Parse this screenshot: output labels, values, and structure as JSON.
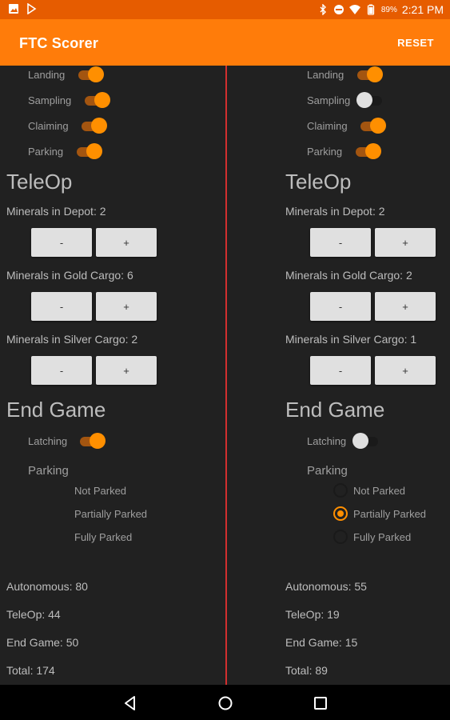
{
  "status_bar": {
    "time": "2:21 PM",
    "battery": "89%",
    "icons": [
      "image-icon",
      "play-store-icon",
      "bluetooth-icon",
      "dnd-icon",
      "wifi-icon",
      "battery-icon"
    ]
  },
  "app_bar": {
    "title": "FTC Scorer",
    "reset_label": "RESET"
  },
  "colors": {
    "accent": "#ff7c0a",
    "divider": "#d32f2f",
    "background": "#212121"
  },
  "teams": [
    {
      "auto": {
        "landing": "Landing",
        "sampling": "Sampling",
        "claiming": "Claiming",
        "parking": "Parking"
      },
      "auto_state": {
        "landing": true,
        "sampling": true,
        "claiming": true,
        "parking": true
      },
      "teleop_title": "TeleOp",
      "depot_label": "Minerals in Depot: 2",
      "gold_label": "Minerals in Gold Cargo: 6",
      "silver_label": "Minerals in Silver Cargo: 2",
      "minus": "-",
      "plus": "+",
      "end_title": "End Game",
      "latching": "Latching",
      "latching_state": true,
      "parking_title": "Parking",
      "parking_options": [
        "Not Parked",
        "Partially Parked",
        "Fully Parked"
      ],
      "parking_selected": null,
      "summary": {
        "auto": "Autonomous: 80",
        "teleop": "TeleOp: 44",
        "end": "End Game: 50",
        "total": "Total: 174"
      }
    },
    {
      "auto": {
        "landing": "Landing",
        "sampling": "Sampling",
        "claiming": "Claiming",
        "parking": "Parking"
      },
      "auto_state": {
        "landing": true,
        "sampling": false,
        "claiming": true,
        "parking": true
      },
      "teleop_title": "TeleOp",
      "depot_label": "Minerals in Depot: 2",
      "gold_label": "Minerals in Gold Cargo: 2",
      "silver_label": "Minerals in Silver Cargo: 1",
      "minus": "-",
      "plus": "+",
      "end_title": "End Game",
      "latching": "Latching",
      "latching_state": false,
      "parking_title": "Parking",
      "parking_options": [
        "Not Parked",
        "Partially Parked",
        "Fully Parked"
      ],
      "parking_selected": 1,
      "summary": {
        "auto": "Autonomous: 55",
        "teleop": "TeleOp: 19",
        "end": "End Game: 15",
        "total": "Total: 89"
      }
    }
  ]
}
